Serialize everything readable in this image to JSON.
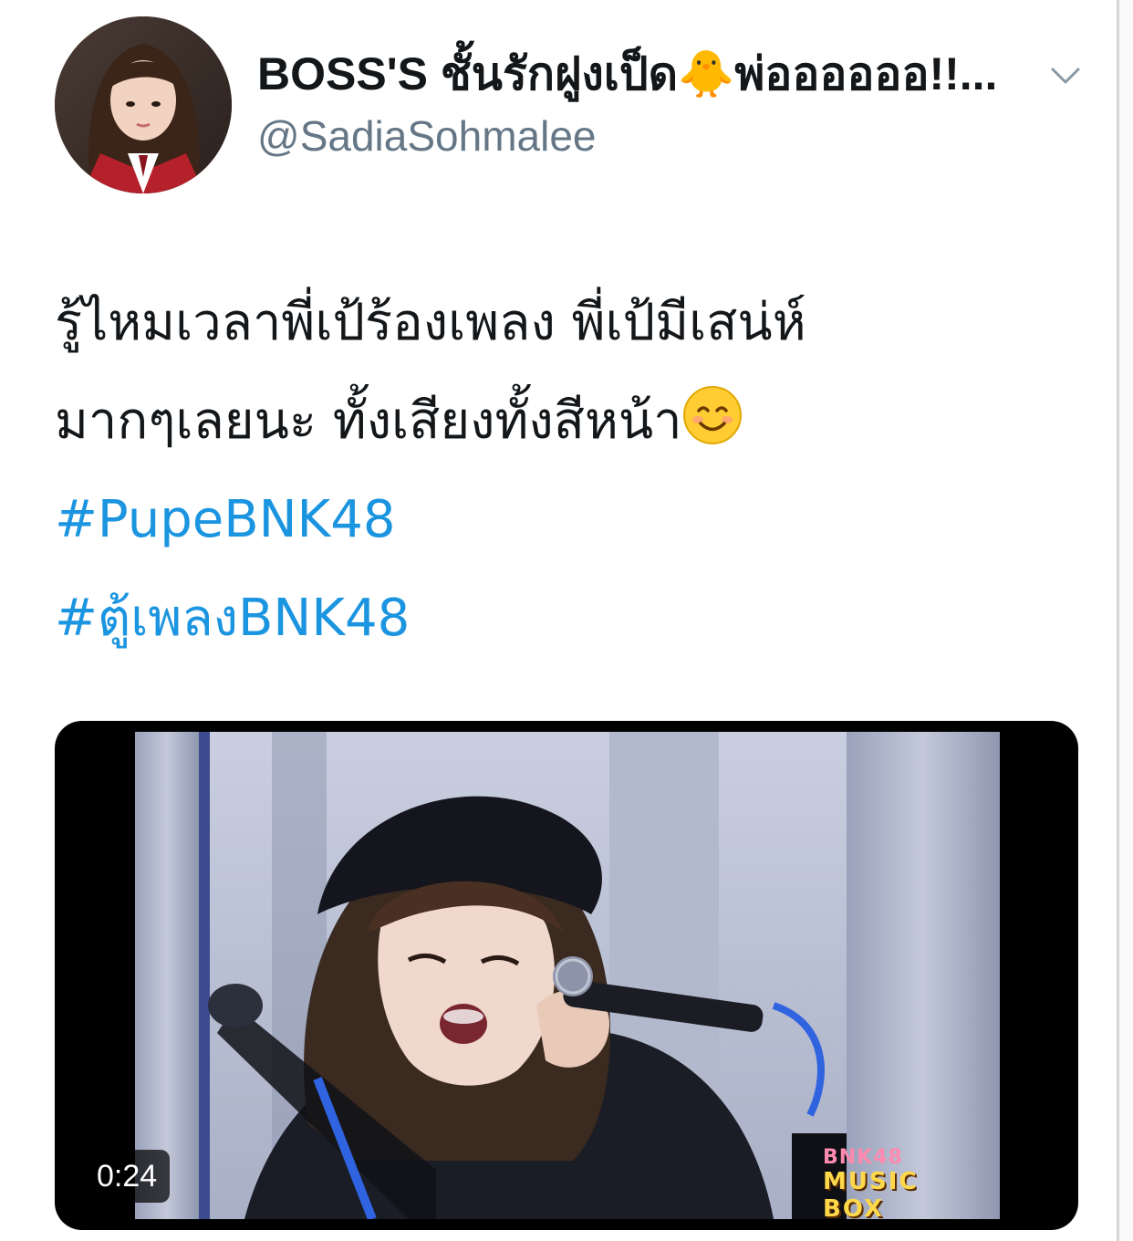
{
  "header": {
    "display_name": "BOSS'S ชั้นรักฝูงเป็ด🐥พ่ออออออ!!...",
    "handle": "@SadiaSohmalee",
    "avatar_icon": "profile-photo",
    "menu_icon": "chevron-down-icon"
  },
  "tweet": {
    "line1": "รู้ไหมเวลาพี่เป้ร้องเพลง พี่เป้มีเสน่ห์",
    "line2": "มากๆเลยนะ ทั้งเสียงทั้งสีหน้า",
    "emoji": "smiling-face-icon",
    "hashtags": [
      "#PupeBNK48",
      "#ตู้เพลงBNK48"
    ]
  },
  "video": {
    "duration": "0:24",
    "logo_top": "BNK48",
    "logo_bottom": "MUSIC BOX"
  },
  "colors": {
    "link": "#1b95e0",
    "secondary_text": "#657786",
    "primary_text": "#14171a"
  }
}
